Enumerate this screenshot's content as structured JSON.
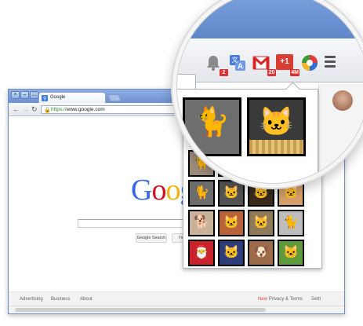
{
  "browser": {
    "tab_title": "Google",
    "tab_favicon": "google-favicon",
    "window_controls": [
      "×",
      "–",
      "□"
    ],
    "url_scheme": "https://",
    "url_host": "www.google.com"
  },
  "google": {
    "logo_letters": [
      "G",
      "o",
      "o",
      "g"
    ],
    "logo_colors": [
      "#3369e8",
      "#d50f25",
      "#eeb211",
      "#3369e8"
    ],
    "search_button": "Google Search",
    "lucky_button": "I'm F",
    "footer": {
      "advertising": "Advertising",
      "business": "Business",
      "about": "About",
      "new_badge": "New",
      "privacy": "Privacy & Terms",
      "settings": "Setti"
    }
  },
  "extensions": {
    "notifications_badge": "2",
    "gmail_badge": "20",
    "gplus_label": "+1",
    "gplus_badge": "4M",
    "icons": [
      "notification-bell-icon",
      "translate-icon",
      "gmail-icon",
      "google-plus-icon",
      "photo-grid-extension-icon",
      "menu-icon"
    ]
  },
  "popup": {
    "thumbnails": [
      {
        "name": "cats-on-bench",
        "icon": "🐈",
        "bg": "#7b7b7b"
      },
      {
        "name": "kittens-in-basket",
        "icon": "🐱",
        "bg": "#4a4a4a"
      },
      {
        "name": "cat-on-rug",
        "icon": "🐈",
        "bg": "#9c8d7b"
      },
      {
        "name": "cat-red",
        "icon": "🐾",
        "bg": "#b5242a"
      },
      {
        "name": "cat-grey",
        "icon": "🐈",
        "bg": "#8f8f8f"
      },
      {
        "name": "cat-dark",
        "icon": "🐱",
        "bg": "#3c3c3c"
      },
      {
        "name": "cat-window",
        "icon": "🐈",
        "bg": "#6d6d6d"
      },
      {
        "name": "kitten-bw",
        "icon": "🐱",
        "bg": "#525252"
      },
      {
        "name": "kitten-glow",
        "icon": "🐱",
        "bg": "#3a2b1c"
      },
      {
        "name": "kittens-pile",
        "icon": "🐱",
        "bg": "#d7a06b"
      },
      {
        "name": "dog-kitten",
        "icon": "🐕",
        "bg": "#c8b39a"
      },
      {
        "name": "hand-kitten",
        "icon": "🐱",
        "bg": "#b8623a"
      },
      {
        "name": "kitten-play",
        "icon": "🐱",
        "bg": "#8e7a5a"
      },
      {
        "name": "cat-mono",
        "icon": "🐈",
        "bg": "#bdbdbd"
      },
      {
        "name": "santa-cat",
        "icon": "🎅",
        "bg": "#c8232b"
      },
      {
        "name": "blue-kitten",
        "icon": "🐱",
        "bg": "#2c3d7a"
      },
      {
        "name": "cat-dog",
        "icon": "🐶",
        "bg": "#9c6b4a"
      },
      {
        "name": "cat-green",
        "icon": "🐱",
        "bg": "#5f9a3c"
      }
    ]
  }
}
